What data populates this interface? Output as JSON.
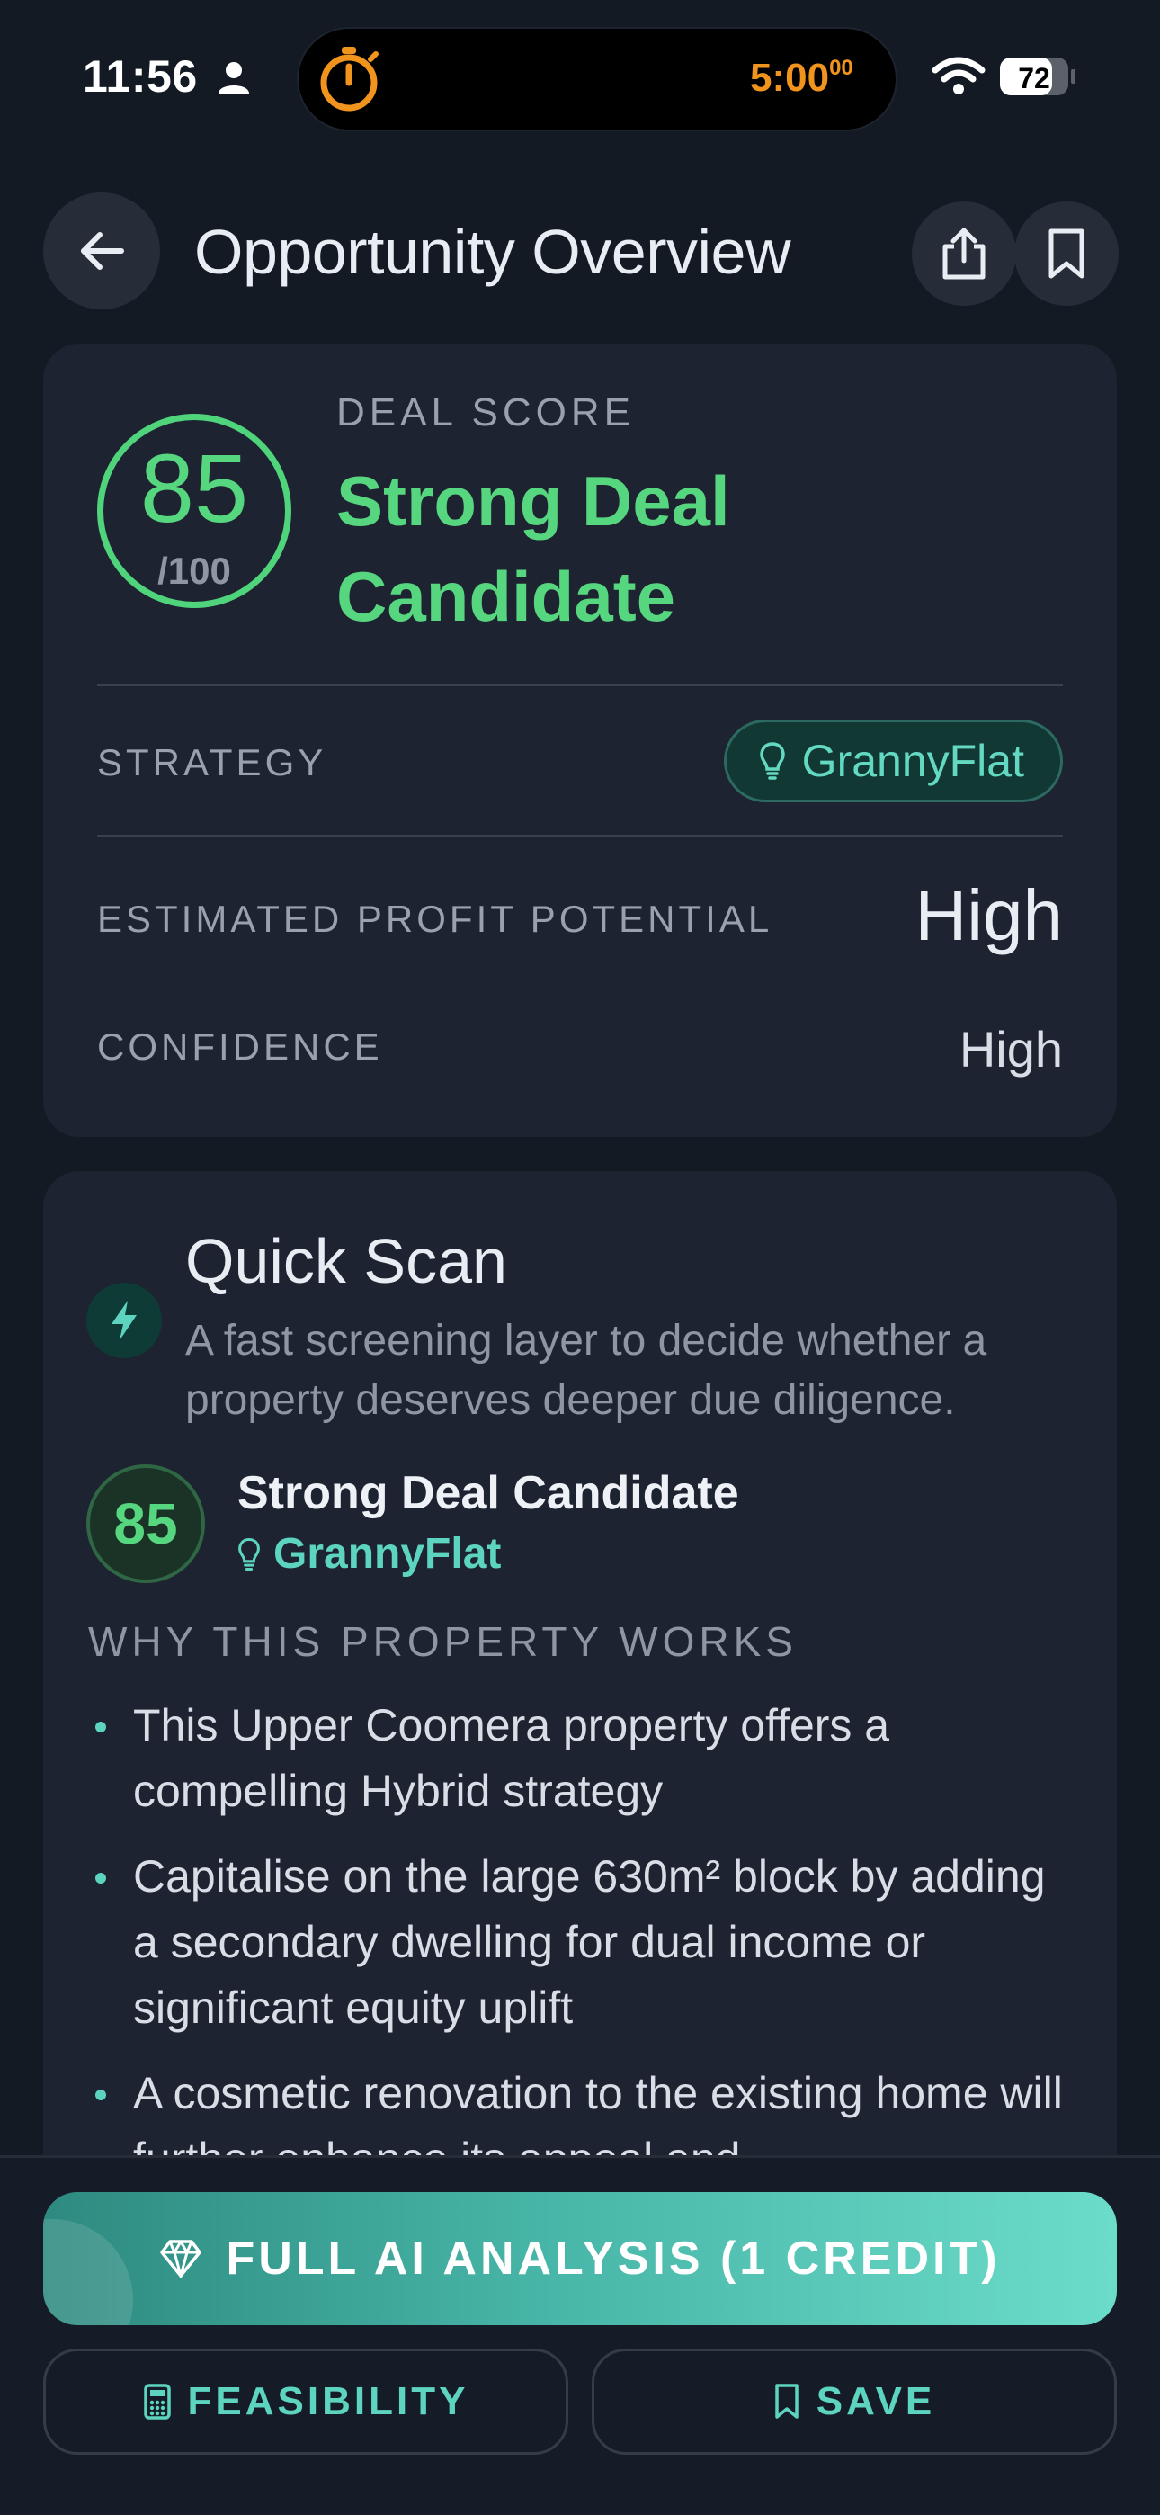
{
  "status_bar": {
    "time": "11:56",
    "timer": "5:00",
    "timer_sup": "00",
    "battery": "72"
  },
  "header": {
    "title": "Opportunity Overview"
  },
  "deal_score": {
    "label": "DEAL SCORE",
    "score": "85",
    "out_of": "/100",
    "verdict": "Strong Deal Candidate",
    "strategy_label": "STRATEGY",
    "strategy": "GrannyFlat",
    "profit_label": "ESTIMATED PROFIT POTENTIAL",
    "profit_value": "High",
    "confidence_label": "CONFIDENCE",
    "confidence_value": "High"
  },
  "quick_scan": {
    "title": "Quick Scan",
    "description": "A fast screening layer to decide whether a property deserves deeper due diligence.",
    "score": "85",
    "verdict": "Strong Deal Candidate",
    "strategy": "GrannyFlat",
    "why_label": "WHY THIS PROPERTY WORKS",
    "reasons": [
      "This Upper Coomera property offers a compelling Hybrid strategy",
      "Capitalise on the large 630m² block by adding a secondary dwelling for dual income or significant equity uplift",
      "A cosmetic renovation to the existing home will further enhance its appeal and"
    ]
  },
  "actions": {
    "full_analysis": "FULL AI ANALYSIS (1 CREDIT)",
    "feasibility": "FEASIBILITY",
    "save": "SAVE"
  },
  "colors": {
    "background": "#141a24",
    "card": "#1d2330",
    "score_green": "#56d67f",
    "teal_accent": "#5cd4bf",
    "timer_orange": "#f0941e"
  }
}
